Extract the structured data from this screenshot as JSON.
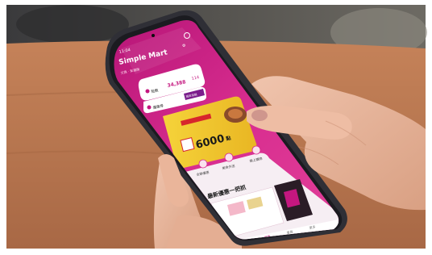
{
  "photo": {
    "scene": "hands-holding-phone-on-wooden-table",
    "app": {
      "status_time": "11:04",
      "brand": "Simple Mart",
      "header_location": "文鼎 · 安通旗",
      "points_value": "34,388",
      "points_extra": "114",
      "row1_label": "點數",
      "row2_label": "優惠券",
      "promo_tag": "限定促銷",
      "banner_price": "6000",
      "banner_unit": "點",
      "shortcut_1": "全聯優惠",
      "shortcut_2": "美食外送",
      "shortcut_3": "線上購物",
      "section_title": "最新優惠一把抓",
      "nav_1": "首頁",
      "nav_2": "會員",
      "nav_3": "更多"
    },
    "colors": {
      "app_magenta": "#c4177f",
      "app_pink": "#e13a97",
      "banner_yellow": "#f2cc2c",
      "table_wood": "#b0704a",
      "phone_frame": "#2f2f36",
      "skin": "#e6b69e"
    }
  }
}
